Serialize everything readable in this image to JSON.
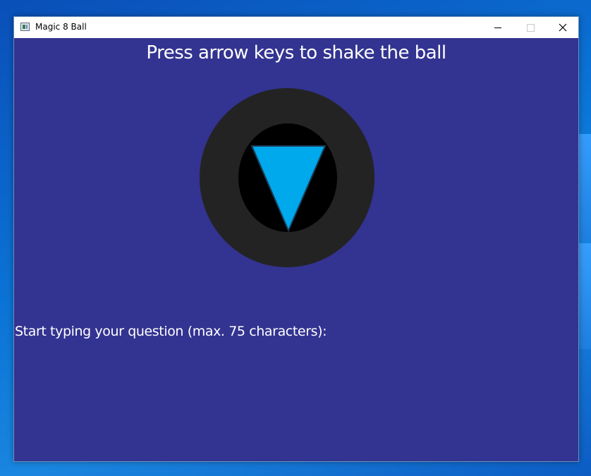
{
  "window": {
    "title": "Magic 8 Ball",
    "icon": "app-window-icon",
    "controls": {
      "minimize_icon": "minimize-icon",
      "maximize_icon": "maximize-icon",
      "close_icon": "close-icon"
    }
  },
  "game": {
    "instruction": "Press arrow keys to shake the ball",
    "question_prompt": "Start typing your question (max. 75 characters):",
    "question_text": "",
    "max_characters": 75,
    "answer_text": ""
  },
  "colors": {
    "background": "#333391",
    "ball_outer": "#232323",
    "ball_window": "#000000",
    "triangle": "#00a8ec",
    "text": "#ffffff"
  }
}
